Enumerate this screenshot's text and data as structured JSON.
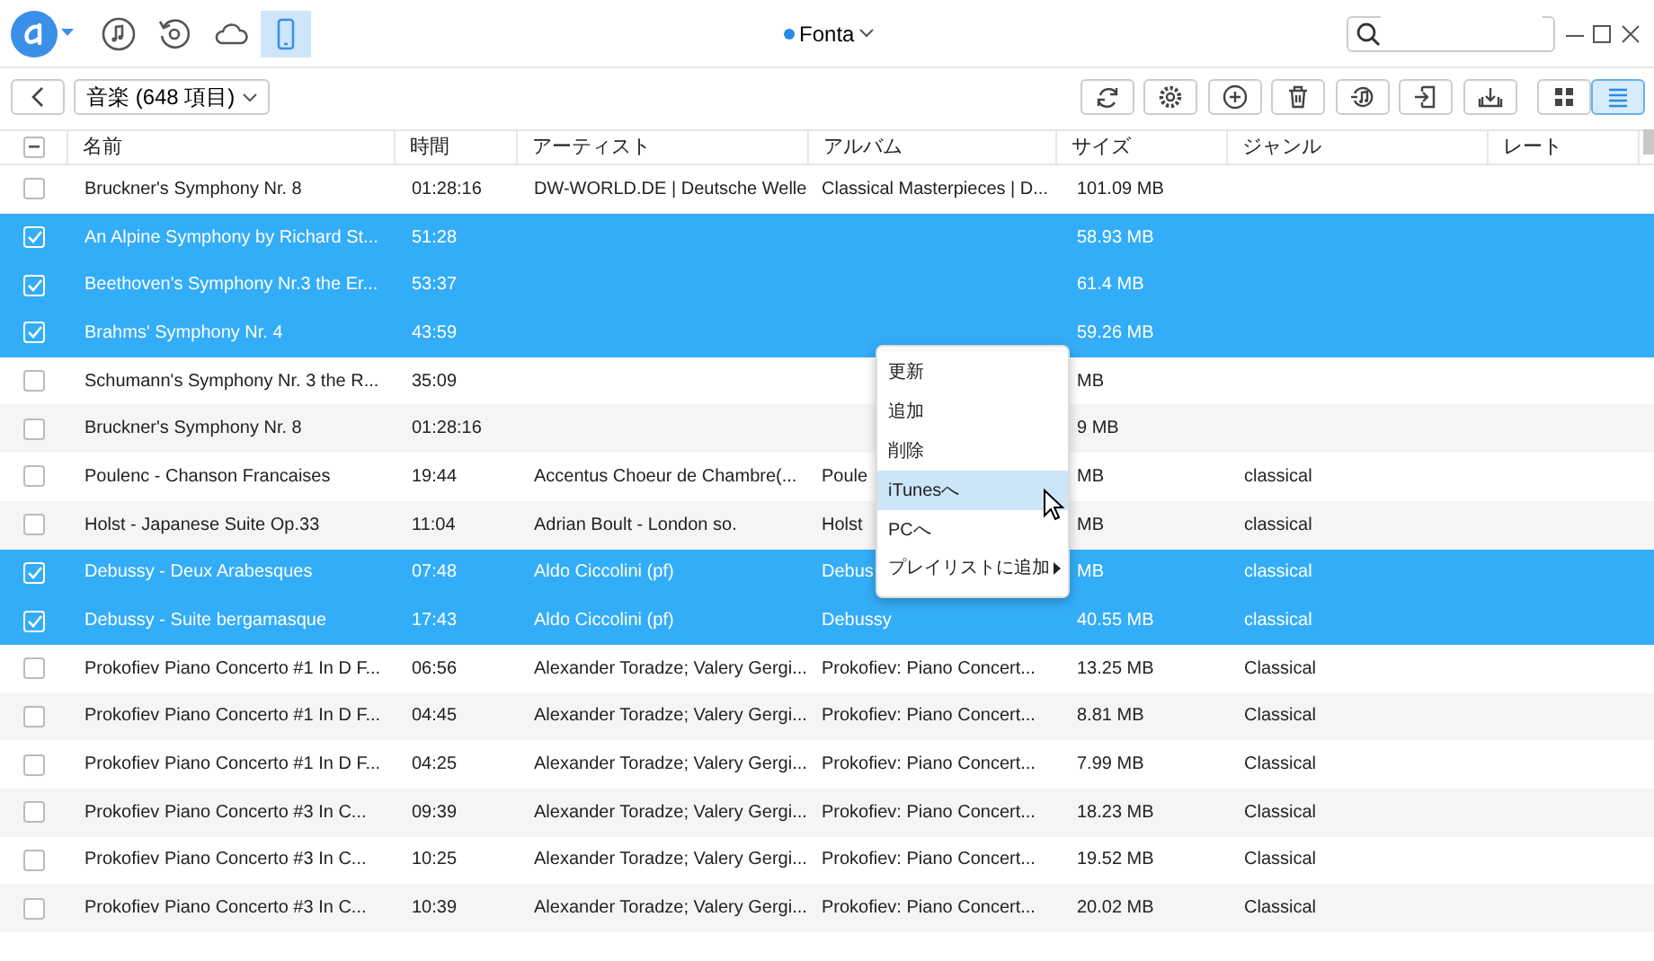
{
  "title_bar": {
    "device": "Fonta",
    "nav_tabs": [
      {
        "selected": false
      },
      {
        "selected": false
      },
      {
        "selected": false
      },
      {
        "selected": true
      }
    ]
  },
  "toolbar": {
    "category": "音楽 (648 項目)",
    "views": [
      {
        "selected": false
      },
      {
        "selected": true
      }
    ]
  },
  "table": {
    "select_all": {
      "indeterminate": true
    },
    "columns": [
      "名前",
      "時間",
      "アーティスト",
      "アルバム",
      "サイズ",
      "ジャンル",
      "レート"
    ],
    "rows": [
      {
        "checked": false,
        "name": "Bruckner's Symphony Nr. 8",
        "time": "01:28:16",
        "artist": "DW-WORLD.DE | Deutsche Welle",
        "album": "Classical Masterpieces | D...",
        "size": "101.09 MB"
      },
      {
        "checked": true,
        "name": "An Alpine Symphony by Richard St...",
        "time": "51:28",
        "size": "58.93 MB"
      },
      {
        "checked": true,
        "name": "Beethoven's Symphony Nr.3 the Er...",
        "time": "53:37",
        "size": "61.4 MB"
      },
      {
        "checked": true,
        "name": "Brahms' Symphony Nr. 4",
        "time": "43:59",
        "size": "59.26 MB"
      },
      {
        "checked": false,
        "name": "Schumann's Symphony Nr. 3 the R...",
        "time": "35:09",
        "size": "MB"
      },
      {
        "checked": false,
        "name": "Bruckner's Symphony Nr. 8",
        "time": "01:28:16",
        "size": "9 MB"
      },
      {
        "checked": false,
        "name": "Poulenc - Chanson Francaises",
        "time": "19:44",
        "artist": "Accentus Choeur de Chambre(...",
        "album": "Poule",
        "size": "MB",
        "genre": "classical"
      },
      {
        "checked": false,
        "name": "Holst - Japanese Suite Op.33",
        "time": "11:04",
        "artist": "Adrian Boult - London so.",
        "album": "Holst",
        "size": "MB",
        "genre": "classical"
      },
      {
        "checked": true,
        "name": "Debussy - Deux Arabesques",
        "time": "07:48",
        "artist": "Aldo Ciccolini (pf)",
        "album": "Debus",
        "size": "MB",
        "genre": "classical"
      },
      {
        "checked": true,
        "name": "Debussy - Suite bergamasque",
        "time": "17:43",
        "artist": "Aldo Ciccolini (pf)",
        "album": "Debussy",
        "size": "40.55 MB",
        "genre": "classical"
      },
      {
        "checked": false,
        "name": "Prokofiev Piano Concerto #1 In D F...",
        "time": "06:56",
        "artist": "Alexander Toradze; Valery Gergi...",
        "album": "Prokofiev: Piano Concert...",
        "size": "13.25 MB",
        "genre": "Classical"
      },
      {
        "checked": false,
        "name": "Prokofiev Piano Concerto #1 In D F...",
        "time": "04:45",
        "artist": "Alexander Toradze; Valery Gergi...",
        "album": "Prokofiev: Piano Concert...",
        "size": "8.81 MB",
        "genre": "Classical"
      },
      {
        "checked": false,
        "name": "Prokofiev Piano Concerto #1 In D F...",
        "time": "04:25",
        "artist": "Alexander Toradze; Valery Gergi...",
        "album": "Prokofiev: Piano Concert...",
        "size": "7.99 MB",
        "genre": "Classical"
      },
      {
        "checked": false,
        "name": "Prokofiev Piano Concerto #3 In C...",
        "time": "09:39",
        "artist": "Alexander Toradze; Valery Gergi...",
        "album": "Prokofiev: Piano Concert...",
        "size": "18.23 MB",
        "genre": "Classical"
      },
      {
        "checked": false,
        "name": "Prokofiev Piano Concerto #3 In C...",
        "time": "10:25",
        "artist": "Alexander Toradze; Valery Gergi...",
        "album": "Prokofiev: Piano Concert...",
        "size": "19.52 MB",
        "genre": "Classical"
      },
      {
        "checked": false,
        "name": "Prokofiev Piano Concerto #3 In C...",
        "time": "10:39",
        "artist": "Alexander Toradze; Valery Gergi...",
        "album": "Prokofiev: Piano Concert...",
        "size": "20.02 MB",
        "genre": "Classical"
      }
    ]
  },
  "context_menu": {
    "items": [
      {
        "label": "更新",
        "selected": false
      },
      {
        "label": "追加",
        "selected": false
      },
      {
        "label": "削除",
        "selected": false
      },
      {
        "label": "iTunesへ",
        "selected": true
      },
      {
        "label": "PCへ",
        "selected": false
      },
      {
        "label": "プレイリストに追加",
        "selected": false,
        "submenu": true
      }
    ]
  }
}
